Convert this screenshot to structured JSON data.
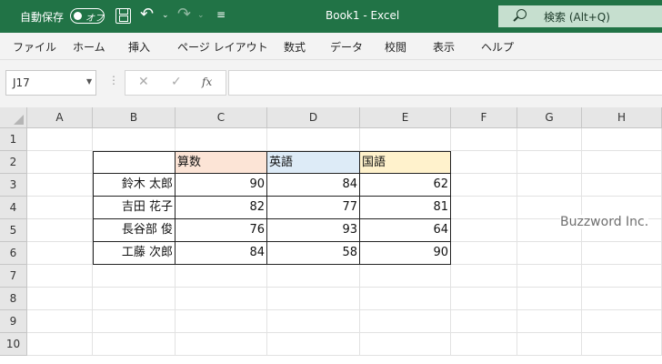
{
  "titlebar": {
    "autosave_label": "自動保存",
    "autosave_state": "オフ",
    "title": "Book1  -  Excel",
    "search_text": "検索 (Alt+Q)"
  },
  "menu": [
    "ファイル",
    "ホーム",
    "挿入",
    "ページ レイアウト",
    "数式",
    "データ",
    "校閲",
    "表示",
    "ヘルプ"
  ],
  "formula_bar": {
    "name_box": "J17",
    "fx": "fx",
    "formula": ""
  },
  "columns": [
    "A",
    "B",
    "C",
    "D",
    "E",
    "F",
    "G",
    "H"
  ],
  "rows": [
    "1",
    "2",
    "3",
    "4",
    "5",
    "6",
    "7",
    "8",
    "9",
    "10"
  ],
  "table": {
    "headers": [
      "",
      "算数",
      "英語",
      "国語"
    ],
    "header_colors": [
      "#ffffff",
      "#fce4d6",
      "#ddebf7",
      "#fff2cc"
    ],
    "rows": [
      [
        "鈴木 太郎",
        "90",
        "84",
        "62"
      ],
      [
        "吉田 花子",
        "82",
        "77",
        "81"
      ],
      [
        "長谷部 俊",
        "76",
        "93",
        "64"
      ],
      [
        "工藤 次郎",
        "84",
        "58",
        "90"
      ]
    ]
  },
  "watermark": "Buzzword Inc.",
  "colors": {
    "accent": "#217346"
  }
}
